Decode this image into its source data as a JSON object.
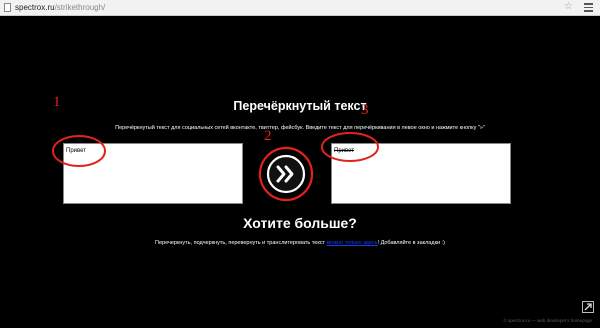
{
  "browser": {
    "url_domain": "spectrox.ru",
    "url_path": "/strikethrough/"
  },
  "page": {
    "title": "Перечёркнутый текст",
    "subtitle": "Перечёркнутый текст для социальных сетей вконтакте, твиттер, фейсбук. Введите текст для перечёркивания в левое окно и нажмите кнопку \"»\"",
    "input_text": "Привет",
    "output_text": "Привет",
    "convert_button_icon": "double-chevron-right-icon",
    "more_title": "Хотите больше?",
    "more_text_before": "Перечеркнуть, подчеркнуть, перевернуть и транслитеровать текст ",
    "more_link": "можно только здесь",
    "more_text_after": "! Добавляйте в закладки :)",
    "footer": "© spectrox.ru — web developer's homepage"
  },
  "annotations": {
    "color": "#e2231a",
    "labels": [
      "1",
      "2",
      "3"
    ]
  }
}
